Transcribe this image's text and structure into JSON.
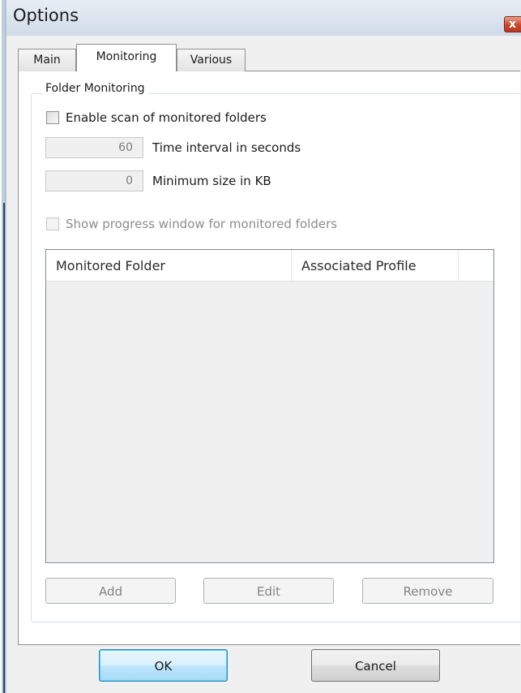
{
  "window": {
    "title": "Options",
    "close_glyph": "x"
  },
  "tabs": [
    {
      "label": "Main",
      "active": false
    },
    {
      "label": "Monitoring",
      "active": true
    },
    {
      "label": "Various",
      "active": false
    }
  ],
  "folder_monitoring": {
    "group_label": "Folder Monitoring",
    "enable_scan": {
      "label": "Enable scan of monitored folders",
      "checked": false
    },
    "time_interval": {
      "value": "60",
      "label": "Time interval in seconds"
    },
    "minimum_size": {
      "value": "0",
      "label": "Minimum size in KB"
    },
    "show_progress": {
      "label": "Show progress window for monitored folders",
      "checked": false,
      "enabled": false
    },
    "table": {
      "columns": [
        "Monitored Folder",
        "Associated Profile",
        ""
      ],
      "rows": []
    },
    "buttons": {
      "add": "Add",
      "edit": "Edit",
      "remove": "Remove"
    }
  },
  "dialog_buttons": {
    "ok": "OK",
    "cancel": "Cancel"
  },
  "colors": {
    "close_button": "#c9462c",
    "default_button_border": "#3c7fb1"
  }
}
